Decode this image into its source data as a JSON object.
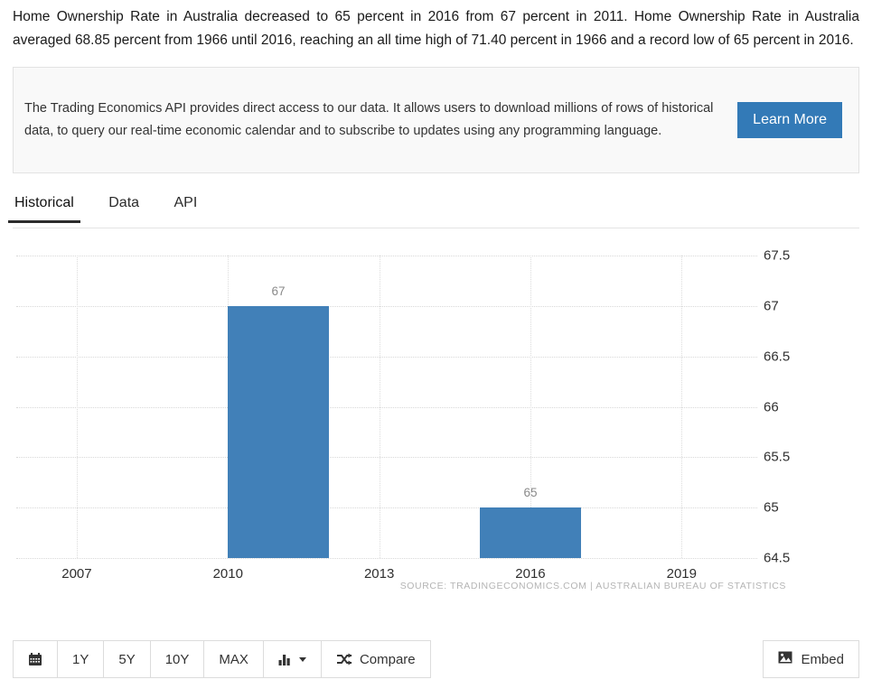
{
  "summary": "Home Ownership Rate in Australia decreased to 65 percent in 2016 from 67 percent in 2011. Home Ownership Rate in Australia averaged 68.85 percent from 1966 until 2016, reaching an all time high of 71.40 percent in 1966 and a record low of 65 percent in 2016.",
  "promo": {
    "text": "The Trading Economics API provides direct access to our data. It allows users to download millions of rows of historical data, to query our real-time economic calendar and to subscribe to updates using any programming language.",
    "button_label": "Learn More",
    "button_color": "#337ab7"
  },
  "tabs": [
    {
      "label": "Historical",
      "active": true
    },
    {
      "label": "Data",
      "active": false
    },
    {
      "label": "API",
      "active": false
    }
  ],
  "chart_data": {
    "type": "bar",
    "title": "",
    "subtitle": "",
    "xlabel": "",
    "ylabel": "",
    "categories": [
      "2011",
      "2016"
    ],
    "values": [
      67,
      65
    ],
    "data_labels": [
      "67",
      "65"
    ],
    "bar_color": "#4180b8",
    "ylim": [
      64.5,
      67.5
    ],
    "y_ticks": [
      "67.5",
      "67",
      "66.5",
      "66",
      "65.5",
      "65",
      "64.5"
    ],
    "y_tick_values": [
      67.5,
      67,
      66.5,
      66,
      65.5,
      65,
      64.5
    ],
    "x_ticks": [
      "2007",
      "2010",
      "2013",
      "2016",
      "2019"
    ],
    "x_tick_values": [
      2007,
      2010,
      2013,
      2016,
      2019
    ],
    "xlim": [
      2005.8,
      2020.5
    ],
    "grid": true,
    "legend": "none",
    "source": "SOURCE: TRADINGECONOMICS.COM  |  AUSTRALIAN BUREAU OF STATISTICS"
  },
  "toolbar": {
    "calendar_icon": "calendar-icon",
    "ranges": [
      "1Y",
      "5Y",
      "10Y",
      "MAX"
    ],
    "chart_type_icon": "bar-chart-icon",
    "compare_icon": "shuffle-icon",
    "compare_label": "Compare",
    "embed_icon": "image-icon",
    "embed_label": "Embed"
  }
}
